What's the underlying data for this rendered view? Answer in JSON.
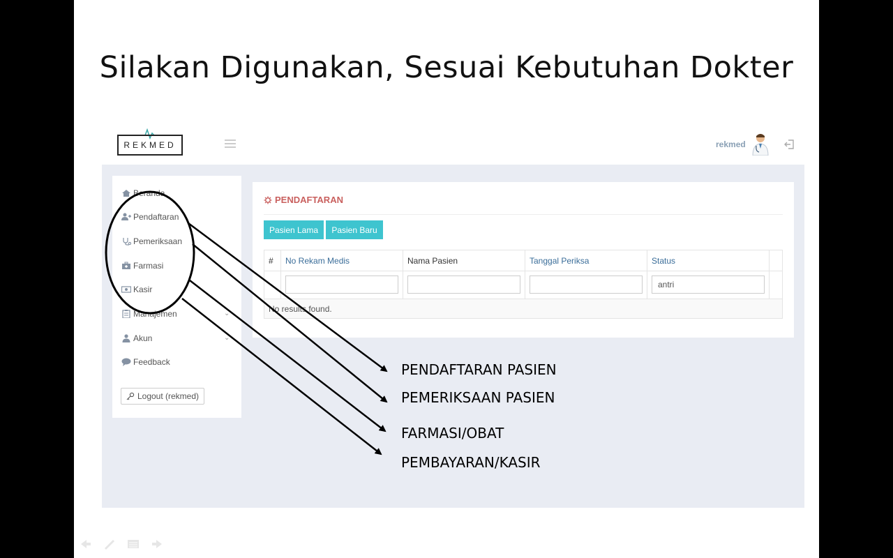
{
  "slide": {
    "title": "Silakan Digunakan, Sesuai Kebutuhan Dokter",
    "callouts": [
      "PENDAFTARAN PASIEN",
      "PEMERIKSAAN PASIEN",
      "FARMASI/OBAT",
      "PEMBAYARAN/KASIR"
    ]
  },
  "app": {
    "logo": "REKMED",
    "user": "rekmed",
    "sidebar": {
      "items": [
        {
          "label": "Beranda",
          "icon": "home-icon"
        },
        {
          "label": "Pendaftaran",
          "icon": "user-add-icon"
        },
        {
          "label": "Pemeriksaan",
          "icon": "stethoscope-icon"
        },
        {
          "label": "Farmasi",
          "icon": "medkit-icon"
        },
        {
          "label": "Kasir",
          "icon": "money-icon"
        },
        {
          "label": "Manajemen",
          "icon": "clipboard-icon"
        },
        {
          "label": "Akun",
          "icon": "user-icon"
        },
        {
          "label": "Feedback",
          "icon": "comment-icon"
        }
      ],
      "logout_label": "Logout (rekmed)"
    },
    "panel": {
      "title": "PENDAFTARAN",
      "buttons": [
        "Pasien Lama",
        "Pasien Baru"
      ],
      "columns": [
        "#",
        "No Rekam Medis",
        "Nama Pasien",
        "Tanggal Periksa",
        "Status"
      ],
      "filters": {
        "no_rekam_medis": "",
        "nama_pasien": "",
        "tanggal_periksa": "",
        "status": "antri"
      },
      "empty_message": "No results found."
    }
  },
  "colors": {
    "accent_button": "#3ec4cf",
    "panel_title": "#c9605e",
    "link_header": "#3a6d99",
    "app_background": "#e9ecf3"
  }
}
